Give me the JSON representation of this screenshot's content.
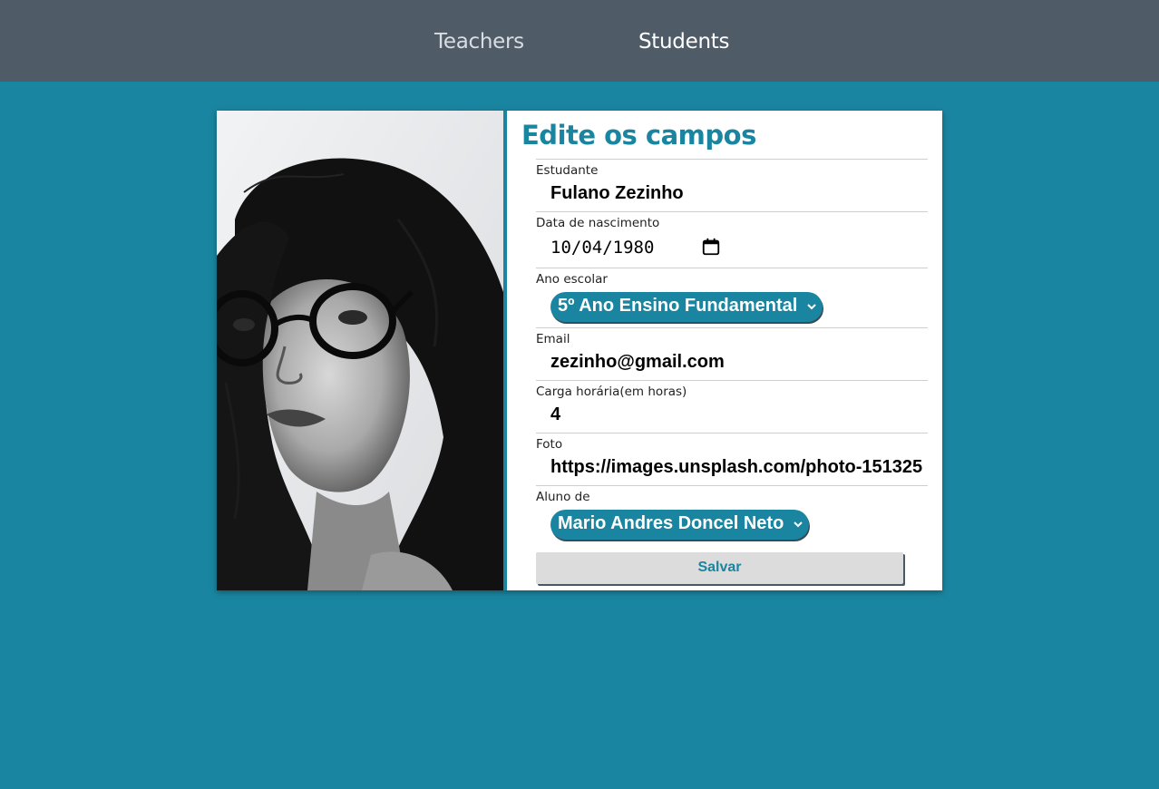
{
  "nav": {
    "teachers": "Teachers",
    "students": "Students"
  },
  "form": {
    "title": "Edite os campos",
    "student": {
      "label": "Estudante",
      "value": "Fulano Zezinho"
    },
    "birth": {
      "label": "Data de nascimento",
      "value": "10/04/1980",
      "icon": "calendar-icon"
    },
    "grade": {
      "label": "Ano escolar",
      "value": "5º Ano Ensino Fundamental"
    },
    "email": {
      "label": "Email",
      "value": "zezinho@gmail.com"
    },
    "hours": {
      "label": "Carga horária(em horas)",
      "value": "4"
    },
    "photo": {
      "label": "Foto",
      "value": "https://images.unsplash.com/photo-151325"
    },
    "teacher": {
      "label": "Aluno de",
      "value": "Mario Andres Doncel Neto"
    },
    "save_label": "Salvar"
  },
  "colors": {
    "accent": "#1a85a0",
    "nav_bg": "#4f5c68",
    "button_bg": "#dcdcdc"
  }
}
